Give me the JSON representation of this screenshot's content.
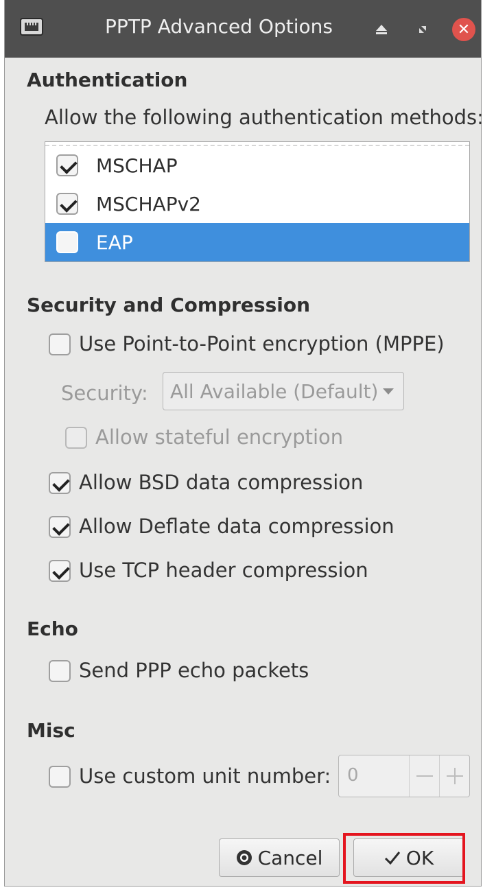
{
  "titlebar": {
    "title": "PPTP Advanced Options",
    "app_icon": "network-icon",
    "buttons": [
      "eject-icon",
      "restore-icon",
      "close-icon"
    ],
    "close_color": "#e0534d"
  },
  "authentication": {
    "heading": "Authentication",
    "description": "Allow the following authentication methods:",
    "methods": [
      {
        "label": "MSCHAP",
        "checked": true,
        "selected": false
      },
      {
        "label": "MSCHAPv2",
        "checked": true,
        "selected": false
      },
      {
        "label": "EAP",
        "checked": false,
        "selected": true
      }
    ],
    "selection_color": "#3f8fdd"
  },
  "security": {
    "heading": "Security and Compression",
    "mppe_label": "Use Point-to-Point encryption (MPPE)",
    "mppe_checked": false,
    "security_label": "Security:",
    "security_value": "All Available (Default)",
    "stateful_label": "Allow stateful encryption",
    "stateful_checked": false,
    "bsd_label": "Allow BSD data compression",
    "bsd_checked": true,
    "deflate_label": "Allow Deflate data compression",
    "deflate_checked": true,
    "tcp_label": "Use TCP header compression",
    "tcp_checked": true
  },
  "echo": {
    "heading": "Echo",
    "send_label": "Send PPP echo packets",
    "send_checked": false
  },
  "misc": {
    "heading": "Misc",
    "unit_label": "Use custom unit number:",
    "unit_checked": false,
    "unit_value": "0"
  },
  "buttons": {
    "cancel_label": "Cancel",
    "ok_label": "OK",
    "highlight_color": "#e4151f"
  }
}
